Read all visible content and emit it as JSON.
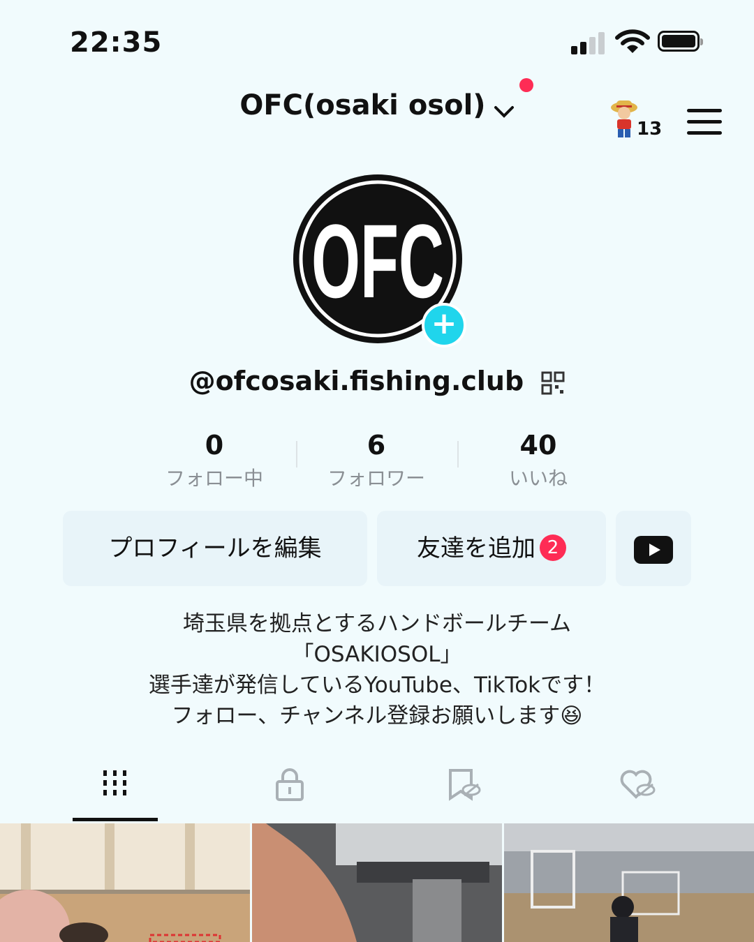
{
  "status_bar": {
    "time": "22:35"
  },
  "header": {
    "username": "OFC(osaki osol)",
    "mascot_count": "13"
  },
  "profile": {
    "avatar_logo": "OFC",
    "handle": "@ofcosaki.fishing.club",
    "stats": [
      {
        "value": "0",
        "label": "フォロー中"
      },
      {
        "value": "6",
        "label": "フォロワー"
      },
      {
        "value": "40",
        "label": "いいね"
      }
    ]
  },
  "buttons": {
    "edit_profile": "プロフィールを編集",
    "add_friends": "友達を追加",
    "add_friends_badge": "2"
  },
  "bio": [
    "埼玉県を拠点とするハンドボールチーム",
    "「OSAKIOSOL」",
    "選手達が発信しているYouTube、TikTokです！",
    "フォロー、チャンネル登録お願いします😆"
  ],
  "tabs": [
    "videos-grid-icon",
    "lock-icon",
    "bookmark-hidden-icon",
    "liked-hidden-icon"
  ],
  "colors": {
    "accent": "#fe2c55",
    "plus": "#20d5ec",
    "background": "#f1fbfd"
  }
}
